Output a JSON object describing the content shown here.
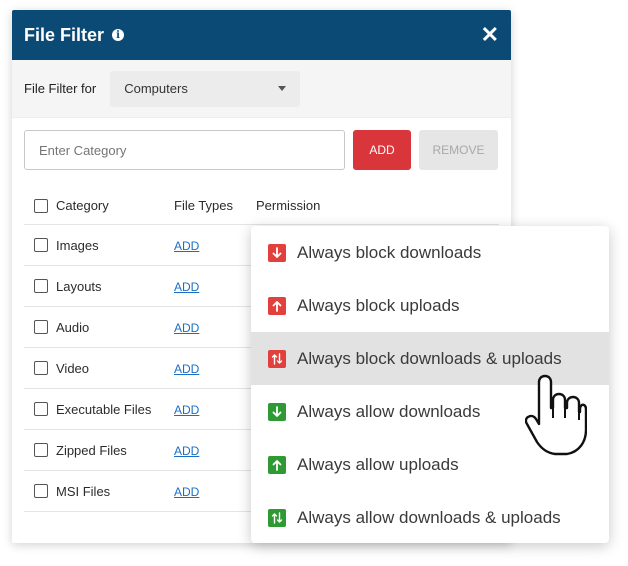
{
  "dialog": {
    "title": "File Filter",
    "close_label": "✕"
  },
  "filter": {
    "label": "File Filter for",
    "selected": "Computers"
  },
  "category_input": {
    "placeholder": "Enter Category"
  },
  "buttons": {
    "add": "ADD",
    "remove": "REMOVE"
  },
  "table": {
    "headers": [
      "Category",
      "File Types",
      "Permission"
    ],
    "rows": [
      {
        "category": "Images",
        "file_types": "ADD"
      },
      {
        "category": "Layouts",
        "file_types": "ADD"
      },
      {
        "category": "Audio",
        "file_types": "ADD"
      },
      {
        "category": "Video",
        "file_types": "ADD"
      },
      {
        "category": "Executable Files",
        "file_types": "ADD"
      },
      {
        "category": "Zipped Files",
        "file_types": "ADD"
      },
      {
        "category": "MSI Files",
        "file_types": "ADD"
      }
    ]
  },
  "permission_menu": {
    "items": [
      {
        "label": "Always block downloads",
        "icon": "arrow-down-icon",
        "color": "#e2403c"
      },
      {
        "label": "Always block uploads",
        "icon": "arrow-up-icon",
        "color": "#e2403c"
      },
      {
        "label": "Always block downloads & uploads",
        "icon": "arrows-up-down-icon",
        "color": "#e2403c"
      },
      {
        "label": "Always allow downloads",
        "icon": "arrow-down-icon",
        "color": "#2f9a33"
      },
      {
        "label": "Always allow uploads",
        "icon": "arrow-up-icon",
        "color": "#2f9a33"
      },
      {
        "label": "Always allow downloads & uploads",
        "icon": "arrows-up-down-icon",
        "color": "#2f9a33"
      }
    ],
    "highlighted_index": 2
  },
  "colors": {
    "header_bg": "#0b4a75",
    "add_button": "#d8363a",
    "link": "#1a6fc4"
  }
}
